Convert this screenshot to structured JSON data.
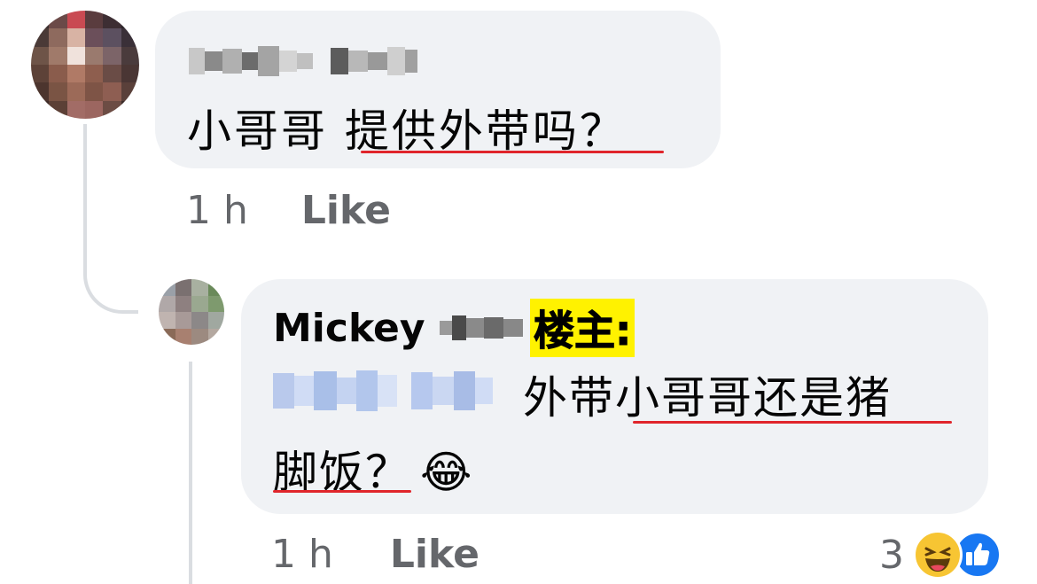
{
  "comment": {
    "author_name_blurred": true,
    "text": "小哥哥 提供外带吗？",
    "time": "1 h",
    "like_label": "Like"
  },
  "reply": {
    "author_name": "Mickey",
    "author_lastname_blurred": true,
    "annotation": "楼主:",
    "mention_blurred": true,
    "text_line1": "外带小哥哥还是猪",
    "text_line2": "脚饭？",
    "emoji": "😂",
    "time": "1 h",
    "like_label": "Like",
    "reaction_count": "3",
    "reactions": [
      "laughing-face",
      "like-thumb"
    ]
  },
  "colors": {
    "bubble": "#f0f2f5",
    "meta": "#65676b",
    "underline": "#e0252b",
    "annotation_bg": "#fff200",
    "like_blue": "#1877f2"
  }
}
